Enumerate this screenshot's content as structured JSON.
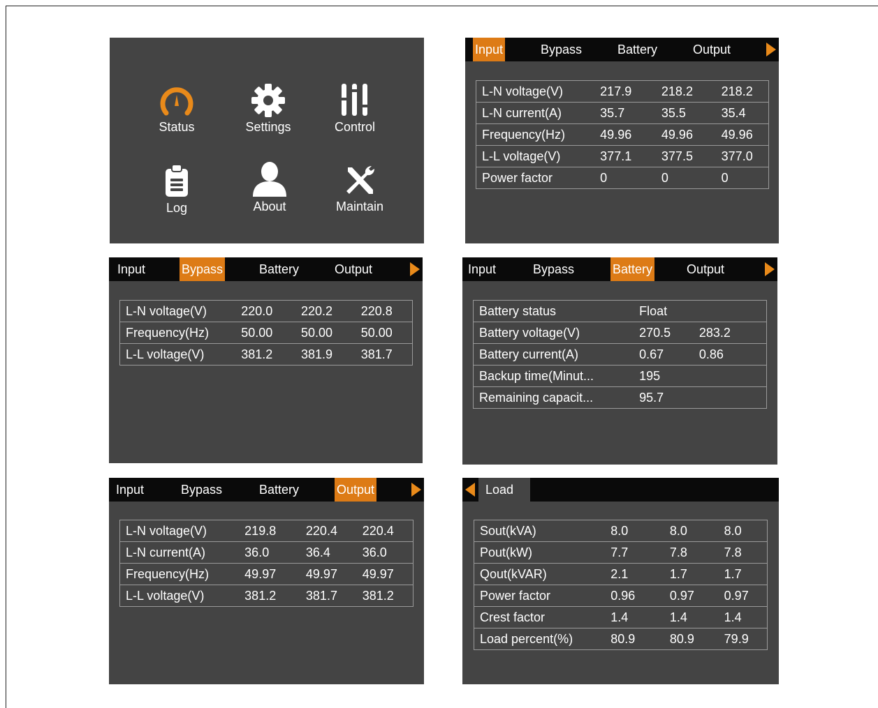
{
  "colors": {
    "accent": "#dd7b16",
    "screen_bg": "#444444",
    "tabbar_bg": "#0a0a0a"
  },
  "home": {
    "items": [
      {
        "label": "Status",
        "icon": "gauge-icon"
      },
      {
        "label": "Settings",
        "icon": "gear-icon"
      },
      {
        "label": "Control",
        "icon": "sliders-icon"
      },
      {
        "label": "Log",
        "icon": "clipboard-icon"
      },
      {
        "label": "About",
        "icon": "person-icon"
      },
      {
        "label": "Maintain",
        "icon": "wrench-screwdriver-icon"
      }
    ]
  },
  "tabs": [
    "Input",
    "Bypass",
    "Battery",
    "Output"
  ],
  "input_screen": {
    "active_tab": "Input",
    "rows": [
      [
        "L-N voltage(V)",
        "217.9",
        "218.2",
        "218.2"
      ],
      [
        "L-N current(A)",
        "35.7",
        "35.5",
        "35.4"
      ],
      [
        "Frequency(Hz)",
        "49.96",
        "49.96",
        "49.96"
      ],
      [
        "L-L voltage(V)",
        "377.1",
        "377.5",
        "377.0"
      ],
      [
        "Power factor",
        "0",
        "0",
        "0"
      ]
    ]
  },
  "bypass_screen": {
    "active_tab": "Bypass",
    "rows": [
      [
        "L-N voltage(V)",
        "220.0",
        "220.2",
        "220.8"
      ],
      [
        "Frequency(Hz)",
        "50.00",
        "50.00",
        "50.00"
      ],
      [
        "L-L voltage(V)",
        "381.2",
        "381.9",
        "381.7"
      ]
    ]
  },
  "battery_screen": {
    "active_tab": "Battery",
    "rows": [
      [
        "Battery status",
        "Float",
        ""
      ],
      [
        "Battery voltage(V)",
        "270.5",
        "283.2"
      ],
      [
        "Battery current(A)",
        "0.67",
        "0.86"
      ],
      [
        "Backup time(Minut...",
        "195",
        ""
      ],
      [
        "Remaining capacit...",
        "95.7",
        ""
      ]
    ]
  },
  "output_screen": {
    "active_tab": "Output",
    "rows": [
      [
        "L-N voltage(V)",
        "219.8",
        "220.4",
        "220.4"
      ],
      [
        "L-N current(A)",
        "36.0",
        "36.4",
        "36.0"
      ],
      [
        "Frequency(Hz)",
        "49.97",
        "49.97",
        "49.97"
      ],
      [
        "L-L voltage(V)",
        "381.2",
        "381.7",
        "381.2"
      ]
    ]
  },
  "load_screen": {
    "tab": "Load",
    "rows": [
      [
        "Sout(kVA)",
        "8.0",
        "8.0",
        "8.0"
      ],
      [
        "Pout(kW)",
        "7.7",
        "7.8",
        "7.8"
      ],
      [
        "Qout(kVAR)",
        "2.1",
        "1.7",
        "1.7"
      ],
      [
        "Power factor",
        "0.96",
        "0.97",
        "0.97"
      ],
      [
        "Crest factor",
        "1.4",
        "1.4",
        "1.4"
      ],
      [
        "Load percent(%)",
        "80.9",
        "80.9",
        "79.9"
      ]
    ]
  }
}
